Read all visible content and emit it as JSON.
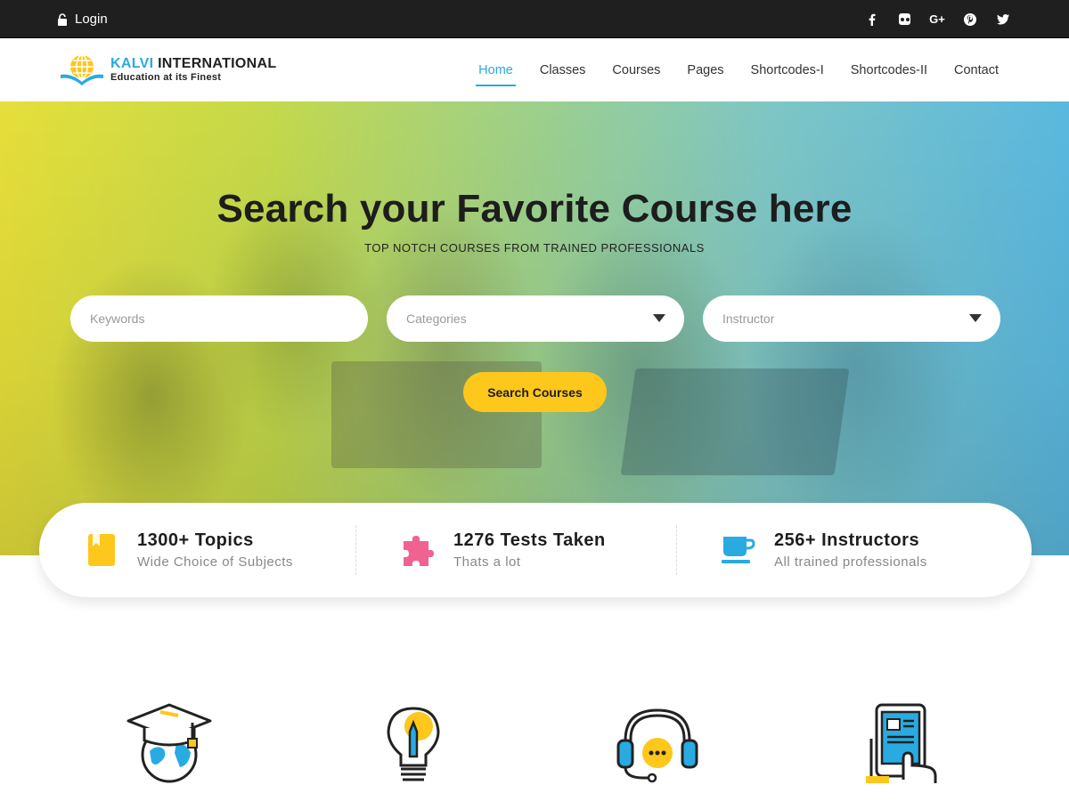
{
  "topbar": {
    "login_label": "Login",
    "login_icon": "lock-icon",
    "socials": [
      "facebook-icon",
      "flickr-icon",
      "google-plus-icon",
      "pinterest-icon",
      "twitter-icon"
    ],
    "google_plus_text": "G+"
  },
  "header": {
    "brand_part1": "KALVI",
    "brand_part2": "INTERNATIONAL",
    "tagline": "Education at its Finest",
    "nav": [
      {
        "label": "Home",
        "active": true
      },
      {
        "label": "Classes"
      },
      {
        "label": "Courses"
      },
      {
        "label": "Pages"
      },
      {
        "label": "Shortcodes-I"
      },
      {
        "label": "Shortcodes-II"
      },
      {
        "label": "Contact"
      }
    ]
  },
  "hero": {
    "title": "Search your Favorite Course here",
    "subtitle": "TOP NOTCH COURSES FROM TRAINED PROFESSIONALS",
    "keywords_placeholder": "Keywords",
    "categories_placeholder": "Categories",
    "instructor_placeholder": "Instructor",
    "search_button": "Search Courses"
  },
  "stats": [
    {
      "number": "1300+ Topics",
      "label": "Wide Choice of Subjects",
      "icon": "bookmark-book-icon",
      "color": "#fdc71b"
    },
    {
      "number": "1276 Tests Taken",
      "label": "Thats a lot",
      "icon": "puzzle-icon",
      "color": "#f06292"
    },
    {
      "number": "256+ Instructors",
      "label": "All trained professionals",
      "icon": "coffee-cup-icon",
      "color": "#29abe2"
    }
  ],
  "features": [
    "graduation-cap-globe-icon",
    "lightbulb-pencil-icon",
    "headset-chat-icon",
    "tablet-touch-icon"
  ],
  "colors": {
    "accent": "#29abe2",
    "button": "#fdc71b",
    "topbar": "#1f1f1f"
  }
}
